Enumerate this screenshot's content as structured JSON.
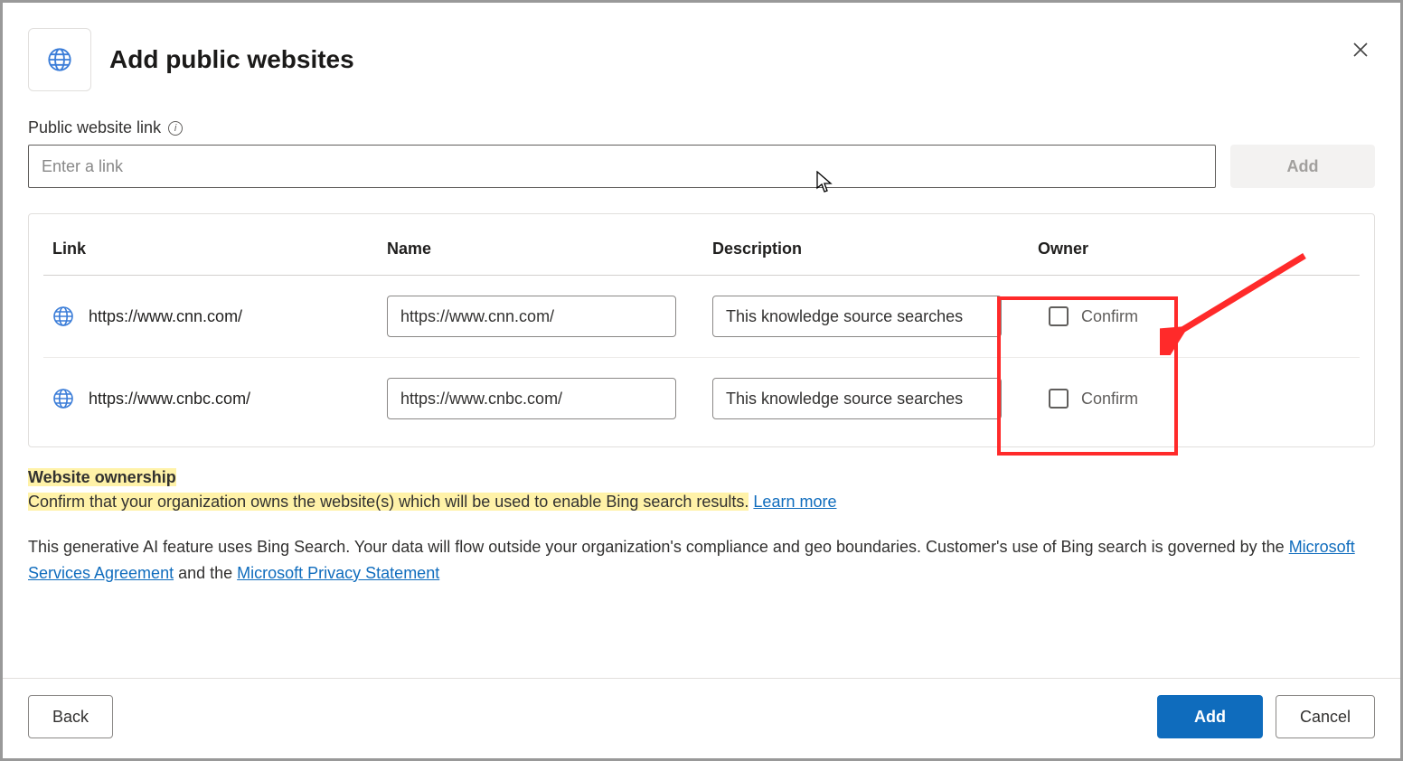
{
  "header": {
    "title": "Add public websites"
  },
  "field": {
    "label": "Public website link",
    "placeholder": "Enter a link",
    "add_button": "Add"
  },
  "table": {
    "headers": {
      "link": "Link",
      "name": "Name",
      "description": "Description",
      "owner": "Owner"
    },
    "rows": [
      {
        "link": "https://www.cnn.com/",
        "name": "https://www.cnn.com/",
        "description": "This knowledge source searches",
        "confirm": "Confirm"
      },
      {
        "link": "https://www.cnbc.com/",
        "name": "https://www.cnbc.com/",
        "description": "This knowledge source searches",
        "confirm": "Confirm"
      }
    ]
  },
  "ownership": {
    "title": "Website ownership",
    "text": "Confirm that your organization owns the website(s) which will be used to enable Bing search results.",
    "learn_more": "Learn more"
  },
  "disclaimer": {
    "pre": "This generative AI feature uses Bing Search. Your data will flow outside your organization's compliance and geo boundaries. Customer's use of Bing search is governed by the ",
    "link1": "Microsoft Services Agreement",
    "mid": " and the ",
    "link2": "Microsoft Privacy Statement"
  },
  "footer": {
    "back": "Back",
    "add": "Add",
    "cancel": "Cancel"
  }
}
